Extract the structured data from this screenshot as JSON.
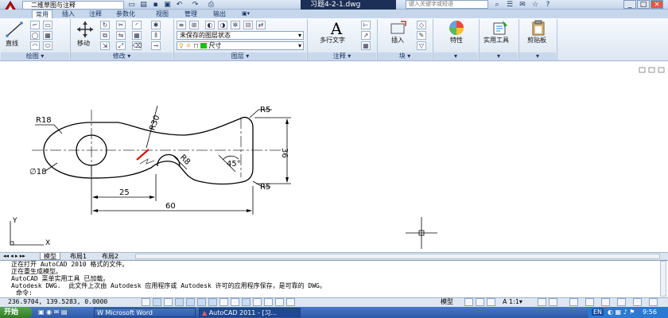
{
  "app": {
    "workspace": "二维草图与注释",
    "doc_title": "习题4-2-1.dwg",
    "search_placeholder": "键入关键字或短语"
  },
  "ribbon": {
    "tabs": [
      "常用",
      "插入",
      "注释",
      "参数化",
      "视图",
      "管理",
      "输出"
    ],
    "active_tab": "常用",
    "panels": [
      {
        "id": "draw",
        "title": "绘图",
        "big_button": "直线"
      },
      {
        "id": "modify",
        "title": "修改",
        "big_button": "移动"
      },
      {
        "id": "layers",
        "title": "图层",
        "layer_state": "未保存的图层状态",
        "current_layer": "尺寸"
      },
      {
        "id": "annotation",
        "title": "注释",
        "big_button": "多行文字"
      },
      {
        "id": "block",
        "title": "块",
        "big_button": "插入"
      },
      {
        "id": "properties",
        "title": "",
        "big_button": "特性"
      },
      {
        "id": "utilities",
        "title": "",
        "big_button": "实用工具"
      },
      {
        "id": "clipboard",
        "title": "",
        "big_button": "剪贴板"
      }
    ]
  },
  "drawing": {
    "dims": {
      "r18": "R18",
      "r30": "R30",
      "r5_top": "R5",
      "r5_bottom": "R5",
      "d18": "∅18",
      "r8": "R8",
      "angle": "45°",
      "d36": "36",
      "d25": "25",
      "d60": "60"
    },
    "ucs": {
      "x": "X",
      "y": "Y"
    }
  },
  "layout_tabs": [
    "模型",
    "布局1",
    "布局2"
  ],
  "active_layout": "模型",
  "command_lines": [
    "正在打开 AutoCAD 2010 格式的文件。",
    "正在重生成模型。",
    "AutoCAD 菜单实用工具 已加载。",
    "Autodesk DWG.  此文件上次由 Autodesk 应用程序或 Autodesk 许可的应用程序保存，是可靠的 DWG。",
    "命令:"
  ],
  "status": {
    "coordinates": "236.9704, 139.5283, 0.0000",
    "model_label": "模型",
    "scale": "1:1"
  },
  "taskbar": {
    "start": "开始",
    "tasks": [
      "Microsoft Word",
      "AutoCAD 2011 - [习..."
    ],
    "lang": "EN",
    "time": "9:56"
  },
  "colors": {
    "accent": "#c6d7ec",
    "current_layer_swatch": "#16c11a",
    "red_glyph": "#e01010",
    "taskbar": "#2c59a8",
    "start": "#2f7d25"
  }
}
